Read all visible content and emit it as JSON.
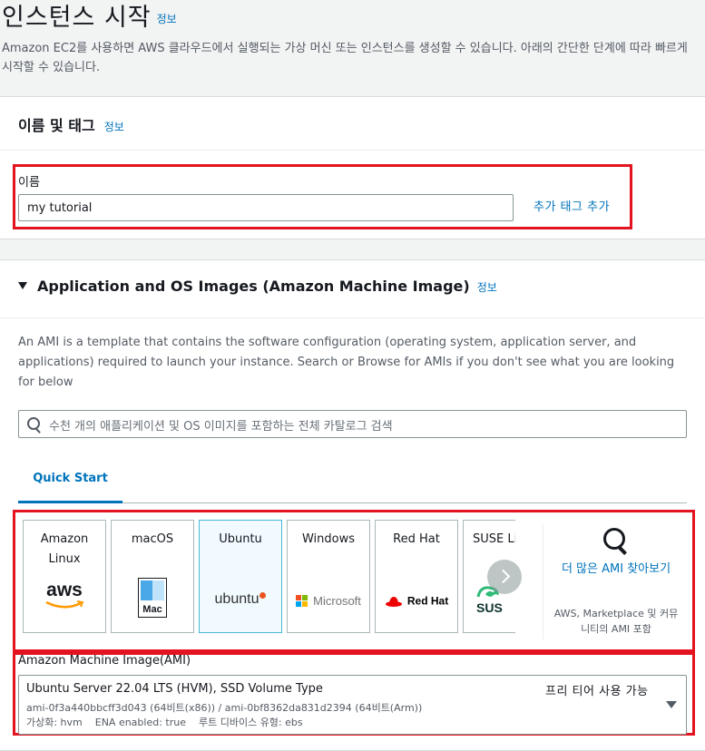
{
  "header": {
    "title": "인스턴스 시작",
    "info": "정보",
    "description": "Amazon EC2를 사용하면 AWS 클라우드에서 실행되는 가상 머신 또는 인스턴스를 생성할 수 있습니다. 아래의 간단한 단계에 따라 빠르게 시작할 수 있습니다."
  },
  "name_tags": {
    "title": "이름 및 태그",
    "info": "정보",
    "name_label": "이름",
    "name_value": "my tutorial",
    "add_tag": "추가 태그 추가"
  },
  "ami_section": {
    "title": "Application and OS Images (Amazon Machine Image)",
    "info": "정보",
    "description": "An AMI is a template that contains the software configuration (operating system, application server, and applications) required to launch your instance. Search or Browse for AMIs if you don't see what you are looking for below",
    "search_placeholder": "수천 개의 애플리케이션 및 OS 이미지를 포함하는 전체 카탈로그 검색",
    "tab": "Quick Start",
    "os_tiles": [
      {
        "name": "Amazon\nLinux",
        "logo": "aws"
      },
      {
        "name": "macOS",
        "logo": "Mac"
      },
      {
        "name": "Ubuntu",
        "logo": "ubuntu"
      },
      {
        "name": "Windows",
        "logo": "Microsoft"
      },
      {
        "name": "Red Hat",
        "logo": "Red Hat"
      },
      {
        "name": "SUSE Li",
        "logo": "SUS"
      }
    ],
    "selected_os": "Ubuntu",
    "browse_more": "더 많은 AMI 찾아보기",
    "browse_sub": "AWS, Marketplace 및 커뮤니티의 AMI 포함",
    "ami_label": "Amazon Machine Image(AMI)",
    "ami_name": "Ubuntu Server 22.04 LTS (HVM), SSD Volume Type",
    "ami_ids": "ami-0f3a440bbcff3d043 (64비트(x86)) / ami-0bf8362da831d2394 (64비트(Arm))",
    "ami_meta": "가상화: hvm    ENA enabled: true    루트 디바이스 유형: ebs",
    "free_tier": "프리 티어 사용 가능"
  },
  "colors": {
    "link": "#0073bb",
    "highlight": "#e3141f",
    "selected_tile": "#f1faff"
  }
}
